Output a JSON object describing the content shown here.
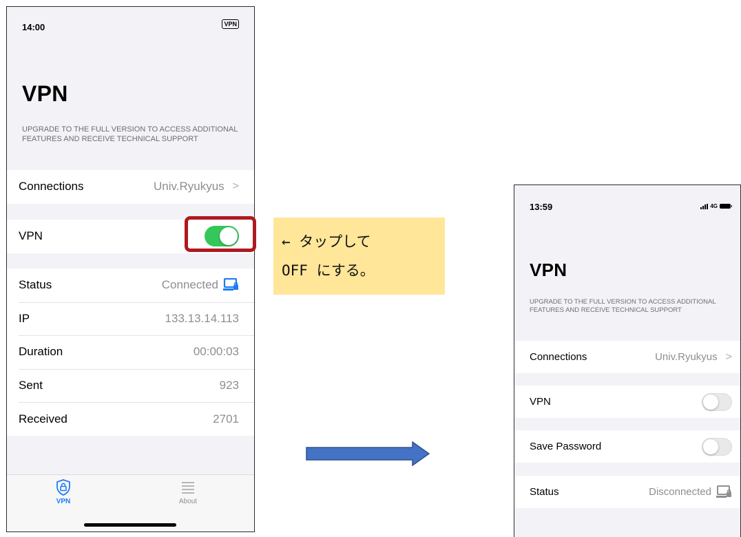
{
  "phone_before": {
    "status_bar": {
      "time": "14:00",
      "vpn_badge": "VPN"
    },
    "title": "VPN",
    "upgrade_note": "UPGRADE TO THE FULL VERSION TO ACCESS ADDITIONAL FEATURES AND RECEIVE TECHNICAL SUPPORT",
    "connections": {
      "label": "Connections",
      "value": "Univ.Ryukyus",
      "chevron": ">"
    },
    "vpn_toggle": {
      "label": "VPN",
      "state": "on",
      "color": "#34c759"
    },
    "status": {
      "label": "Status",
      "value": "Connected",
      "icon": "computer-lock-icon",
      "icon_color": "#1c7cf4"
    },
    "ip": {
      "label": "IP",
      "value": "133.13.14.113"
    },
    "duration": {
      "label": "Duration",
      "value": "00:00:03"
    },
    "sent": {
      "label": "Sent",
      "value": "923"
    },
    "received": {
      "label": "Received",
      "value": "2701"
    },
    "tabs": [
      {
        "label": "VPN",
        "icon": "shield-lock-icon",
        "active": true
      },
      {
        "label": "About",
        "icon": "list-icon",
        "active": false
      }
    ]
  },
  "annotation": {
    "highlight_color": "#b0191f",
    "callout_bg": "#ffe699",
    "callout_lines": [
      "← タップして",
      "OFF にする。"
    ],
    "arrow_color": "#4472c4"
  },
  "phone_after": {
    "status_bar": {
      "time": "13:59",
      "network": "4G"
    },
    "title": "VPN",
    "upgrade_note": "UPGRADE TO THE FULL VERSION TO ACCESS ADDITIONAL FEATURES AND RECEIVE TECHNICAL SUPPORT",
    "connections": {
      "label": "Connections",
      "value": "Univ.Ryukyus",
      "chevron": ">"
    },
    "vpn_toggle": {
      "label": "VPN",
      "state": "off"
    },
    "save_password_toggle": {
      "label": "Save Password",
      "state": "off"
    },
    "status": {
      "label": "Status",
      "value": "Disconnected",
      "icon": "computer-lock-icon",
      "icon_color": "#8e8e93"
    }
  }
}
